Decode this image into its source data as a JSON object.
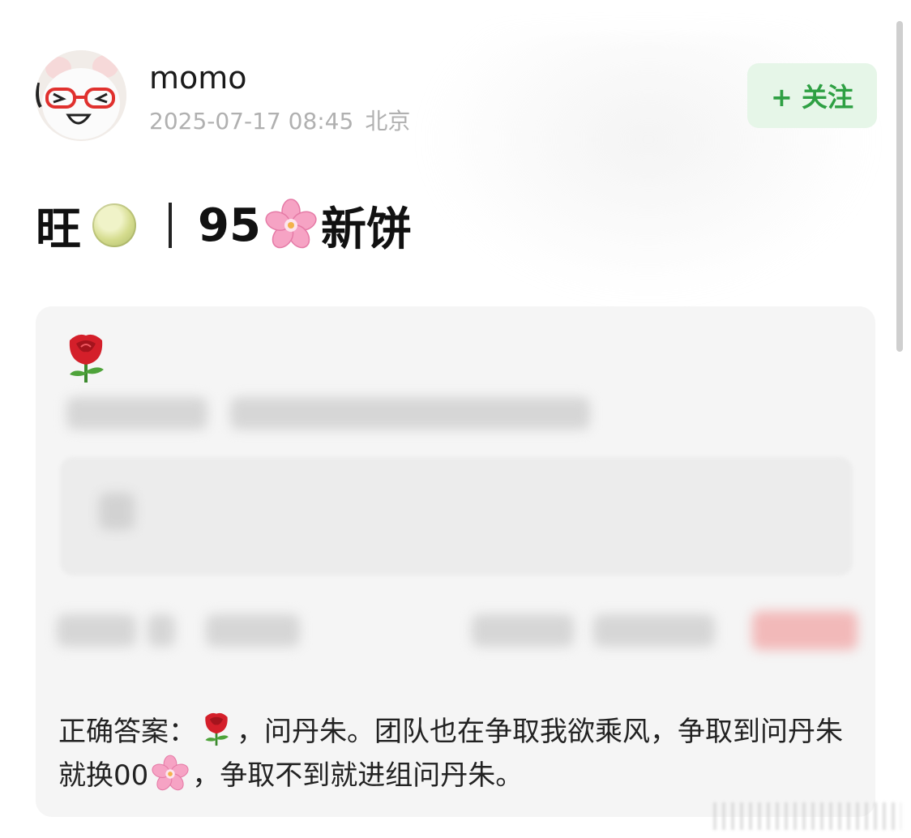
{
  "post": {
    "author_name": "momo",
    "timestamp": "2025-07-17 08:45",
    "location": "北京",
    "follow_label": "+ 关注",
    "title_left": "旺",
    "title_number": "95",
    "title_right": "新饼"
  },
  "content": {
    "answer_part1": "正确答案：",
    "answer_part2": "，问丹朱。团队也在争取我欲乘风，争取到问丹朱就换00",
    "answer_part3": "，争取不到就进组问丹朱。"
  },
  "icons": {
    "title_icon_1": "melon-emoji",
    "title_icon_2": "cherry-blossom-emoji",
    "card_icon": "rose-emoji"
  },
  "colors": {
    "follow_text": "#2ea043",
    "follow_bg": "#e6f6e8",
    "meta_text": "#b0b0b0",
    "card_bg": "#f5f5f5"
  }
}
